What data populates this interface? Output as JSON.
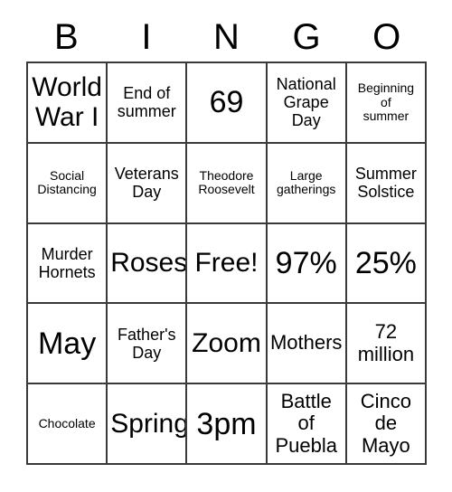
{
  "card": {
    "headers": [
      "B",
      "I",
      "N",
      "G",
      "O"
    ],
    "rows": [
      [
        {
          "text": "World\nWar I",
          "size": "fs-lg"
        },
        {
          "text": "End of\nsummer",
          "size": "fs-sm"
        },
        {
          "text": "69",
          "size": "fs-xl"
        },
        {
          "text": "National\nGrape\nDay",
          "size": "fs-sm"
        },
        {
          "text": "Beginning\nof\nsummer",
          "size": "fs-xs"
        }
      ],
      [
        {
          "text": "Social\nDistancing",
          "size": "fs-xs"
        },
        {
          "text": "Veterans\nDay",
          "size": "fs-sm"
        },
        {
          "text": "Theodore\nRoosevelt",
          "size": "fs-xs"
        },
        {
          "text": "Large\ngatherings",
          "size": "fs-xs"
        },
        {
          "text": "Summer\nSolstice",
          "size": "fs-sm"
        }
      ],
      [
        {
          "text": "Murder\nHornets",
          "size": "fs-sm"
        },
        {
          "text": "Roses",
          "size": "fs-lg"
        },
        {
          "text": "Free!",
          "size": "fs-lg"
        },
        {
          "text": "97%",
          "size": "fs-xl"
        },
        {
          "text": "25%",
          "size": "fs-xl"
        }
      ],
      [
        {
          "text": "May",
          "size": "fs-xl"
        },
        {
          "text": "Father's\nDay",
          "size": "fs-sm"
        },
        {
          "text": "Zoom",
          "size": "fs-lg"
        },
        {
          "text": "Mothers",
          "size": "fs-md"
        },
        {
          "text": "72\nmillion",
          "size": "fs-md"
        }
      ],
      [
        {
          "text": "Chocolate",
          "size": "fs-xs"
        },
        {
          "text": "Spring",
          "size": "fs-lg"
        },
        {
          "text": "3pm",
          "size": "fs-xl"
        },
        {
          "text": "Battle\nof\nPuebla",
          "size": "fs-md"
        },
        {
          "text": "Cinco\nde\nMayo",
          "size": "fs-md"
        }
      ]
    ]
  },
  "colors": {
    "border": "#3a3a3a",
    "text": "#000000",
    "background": "#ffffff"
  }
}
